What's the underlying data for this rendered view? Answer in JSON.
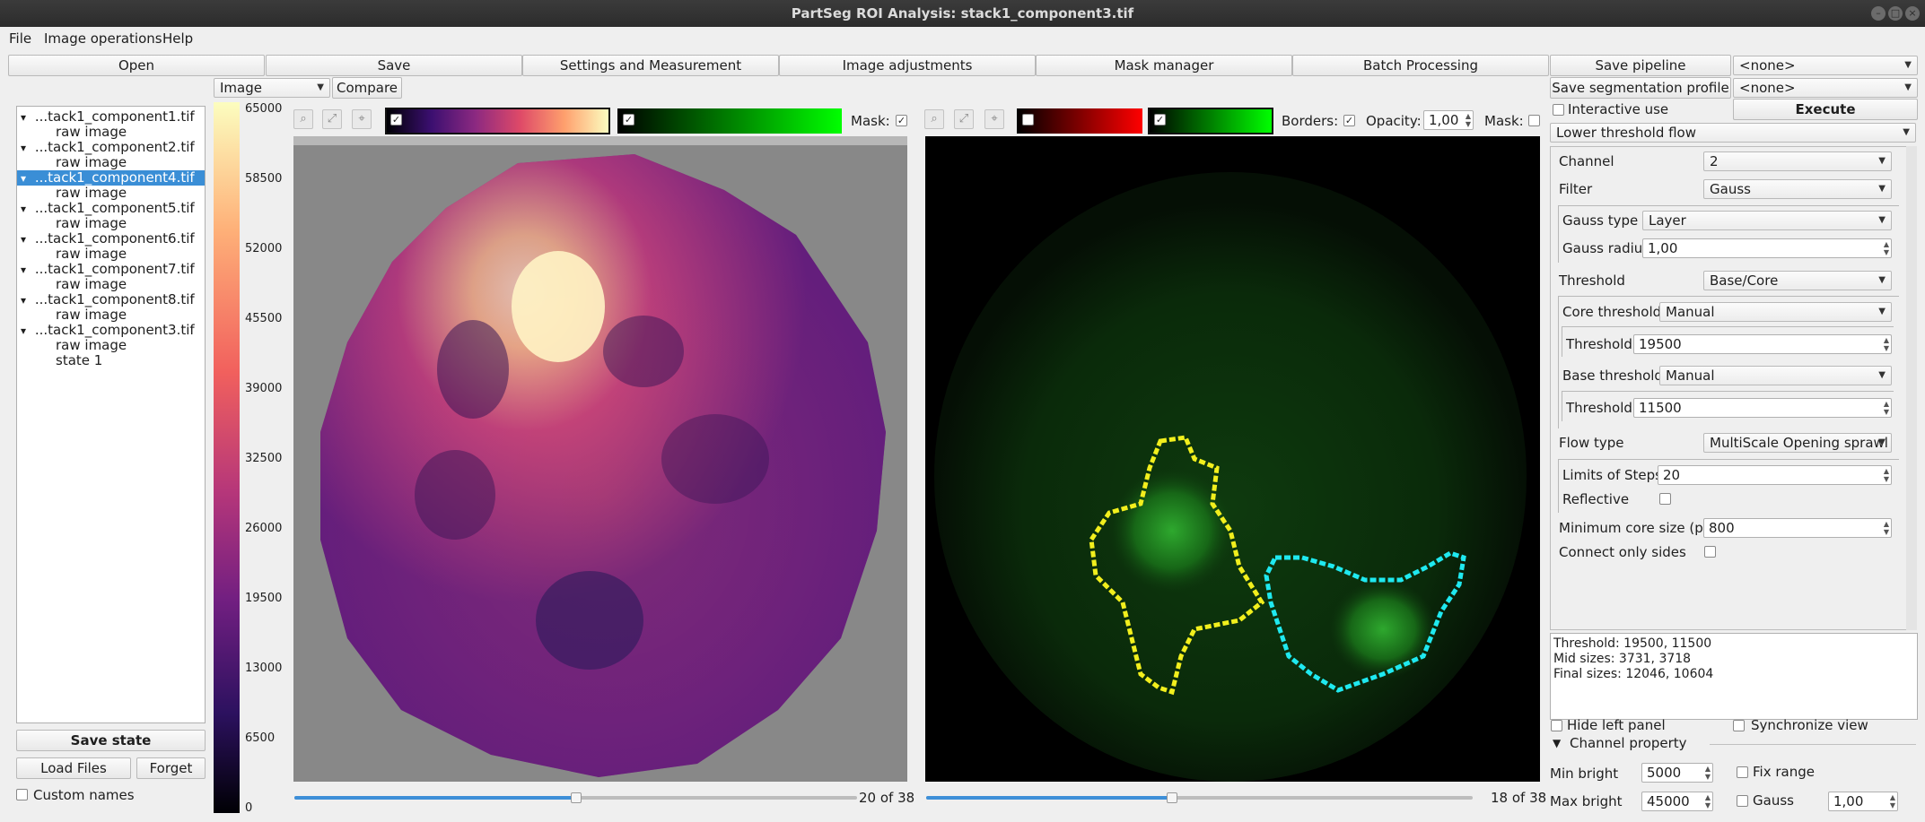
{
  "window": {
    "title": "PartSeg ROI Analysis: stack1_component3.tif"
  },
  "menu": [
    "File",
    "Image operations",
    "Help"
  ],
  "toolbar": {
    "open": "Open",
    "save": "Save",
    "settings": "Settings and Measurement",
    "image_adjustments": "Image adjustments",
    "mask_manager": "Mask manager",
    "batch": "Batch Processing",
    "save_pipeline": "Save pipeline",
    "pipeline_value": "<none>",
    "save_profile": "Save segmentation profile",
    "profile_value": "<none>"
  },
  "file_tree": {
    "items": [
      {
        "name": "...tack1_component1.tif",
        "children": [
          "raw image"
        ],
        "selected": false
      },
      {
        "name": "...tack1_component2.tif",
        "children": [
          "raw image"
        ],
        "selected": false
      },
      {
        "name": "...tack1_component4.tif",
        "children": [
          "raw image"
        ],
        "selected": true
      },
      {
        "name": "...tack1_component5.tif",
        "children": [
          "raw image"
        ],
        "selected": false
      },
      {
        "name": "...tack1_component6.tif",
        "children": [
          "raw image"
        ],
        "selected": false
      },
      {
        "name": "...tack1_component7.tif",
        "children": [
          "raw image"
        ],
        "selected": false
      },
      {
        "name": "...tack1_component8.tif",
        "children": [
          "raw image"
        ],
        "selected": false
      },
      {
        "name": "...tack1_component3.tif",
        "children": [
          "raw image",
          "state 1"
        ],
        "selected": false
      }
    ],
    "save_state": "Save state",
    "load_files": "Load Files",
    "forget": "Forget",
    "custom_names": "Custom names"
  },
  "left_view": {
    "selector": "Image",
    "compare": "Compare",
    "mask_label": "Mask:",
    "mask_checked": true,
    "slice": "20 of 38",
    "slice_fraction": 0.5,
    "colorbar_ticks": [
      "65000",
      "58500",
      "52000",
      "45500",
      "39000",
      "32500",
      "26000",
      "19500",
      "13000",
      "6500",
      "0"
    ]
  },
  "right_view": {
    "borders_label": "Borders:",
    "borders_checked": true,
    "opacity_label": "Opacity:",
    "opacity_value": "1,00",
    "mask_label": "Mask:",
    "slice": "18 of 38",
    "slice_fraction": 0.45
  },
  "algorithm": {
    "interactive_use": "Interactive use",
    "execute": "Execute",
    "method": "Lower threshold flow",
    "channel_label": "Channel",
    "channel_value": "2",
    "filter_label": "Filter",
    "filter_value": "Gauss",
    "gauss_type_label": "Gauss type",
    "gauss_type_value": "Layer",
    "gauss_radius_label": "Gauss radius",
    "gauss_radius_value": "1,00",
    "threshold_label": "Threshold",
    "threshold_value": "Base/Core",
    "core_threshold_label": "Core threshold",
    "core_threshold_value": "Manual",
    "core_thr_label": "Threshold",
    "core_thr_value": "19500",
    "base_threshold_label": "Base threshold",
    "base_threshold_value": "Manual",
    "base_thr_label": "Threshold",
    "base_thr_value": "11500",
    "flow_type_label": "Flow type",
    "flow_type_value": "MultiScale Opening sprawl",
    "limits_label": "Limits of Steps",
    "limits_value": "20",
    "reflective_label": "Reflective",
    "min_core_label": "Minimum core size (px)",
    "min_core_value": "800",
    "connect_label": "Connect only sides"
  },
  "info": {
    "line1": "Threshold: 19500, 11500",
    "line2": "Mid sizes: 3731, 3718",
    "line3": "Final sizes: 12046, 10604"
  },
  "bottom": {
    "hide_left": "Hide left panel",
    "sync_view": "Synchronize view",
    "channel_property": "Channel property",
    "min_bright_label": "Min bright",
    "min_bright_value": "5000",
    "max_bright_label": "Max bright",
    "max_bright_value": "45000",
    "fix_range": "Fix range",
    "gauss": "Gauss",
    "gauss_value": "1,00"
  }
}
